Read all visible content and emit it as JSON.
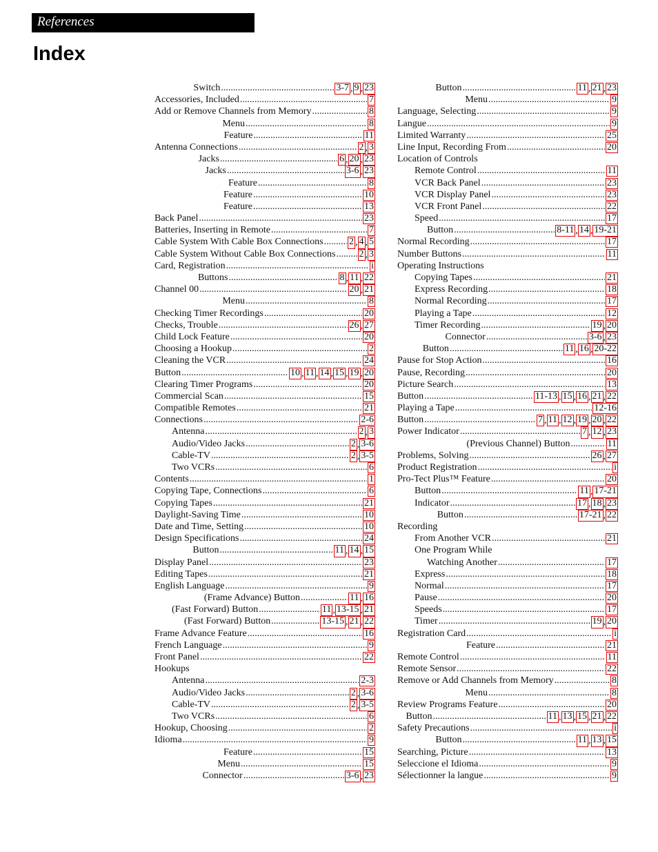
{
  "header": {
    "section": "References",
    "title": "Index"
  },
  "left_column": [
    {
      "label": "Switch",
      "indent": "center",
      "pages": [
        "3-7",
        "9",
        "23"
      ]
    },
    {
      "label": "Accessories, Included",
      "pages": [
        "7"
      ]
    },
    {
      "label": "Add or Remove Channels from Memory",
      "pages": [
        "8"
      ]
    },
    {
      "label": "Menu",
      "indent": "center",
      "pages": [
        "8"
      ]
    },
    {
      "label": "Feature",
      "indent": "center",
      "pages": [
        "11"
      ]
    },
    {
      "label": "Antenna Connections",
      "pages": [
        "2",
        "3"
      ]
    },
    {
      "label": "Jacks",
      "indent": "center",
      "pages": [
        "6",
        "20",
        "23"
      ]
    },
    {
      "label": "Jacks",
      "indent": "center",
      "pages": [
        "3-6",
        "23"
      ]
    },
    {
      "label": "Feature",
      "indent": "center",
      "pages": [
        "8"
      ]
    },
    {
      "label": "Feature",
      "indent": "center",
      "pages": [
        "10"
      ]
    },
    {
      "label": "Feature",
      "indent": "center",
      "pages": [
        "13"
      ]
    },
    {
      "label": "Back Panel",
      "pages": [
        "23"
      ]
    },
    {
      "label": "Batteries, Inserting in Remote",
      "pages": [
        "7"
      ]
    },
    {
      "label": "Cable System With Cable Box Connections",
      "pages": [
        "2",
        "4",
        "5"
      ]
    },
    {
      "label": "Cable System Without Cable Box Connections",
      "pages": [
        "2",
        "3"
      ]
    },
    {
      "label": "Card, Registration",
      "pages": [
        "i"
      ]
    },
    {
      "label": "Buttons",
      "indent": "center",
      "pages": [
        "8",
        "11",
        "22"
      ]
    },
    {
      "label": "Channel 00",
      "pages": [
        "20",
        "21"
      ]
    },
    {
      "label": "Menu",
      "indent": "center",
      "pages": [
        "8"
      ]
    },
    {
      "label": "Checking Timer Recordings",
      "pages": [
        "20"
      ]
    },
    {
      "label": "Checks, Trouble",
      "pages": [
        "26",
        "27"
      ]
    },
    {
      "label": "Child Lock Feature",
      "pages": [
        "20"
      ]
    },
    {
      "label": "Choosing a Hookup",
      "pages": [
        "2"
      ]
    },
    {
      "label": "Cleaning the VCR",
      "pages": [
        "24"
      ]
    },
    {
      "label": "Button",
      "indent": "center",
      "pages": [
        "10",
        "11",
        "14",
        "15",
        "19",
        "20"
      ]
    },
    {
      "label": "Clearing Timer Programs",
      "pages": [
        "20"
      ]
    },
    {
      "label": "Commercial Scan",
      "pages": [
        "15"
      ]
    },
    {
      "label": "Compatible Remotes",
      "pages": [
        "21"
      ]
    },
    {
      "label": "Connections",
      "pages": [
        "2-6"
      ]
    },
    {
      "label": "Antenna",
      "indent": "sub",
      "pages": [
        "2",
        "3"
      ]
    },
    {
      "label": "Audio/Video Jacks",
      "indent": "sub",
      "pages": [
        "2",
        "3-6"
      ]
    },
    {
      "label": "Cable-TV",
      "indent": "sub",
      "pages": [
        "2",
        "3-5"
      ]
    },
    {
      "label": "Two VCRs",
      "indent": "sub",
      "pages": [
        "6"
      ]
    },
    {
      "label": "Contents",
      "pages": [
        "1"
      ]
    },
    {
      "label": "Copying Tape, Connections",
      "pages": [
        "6"
      ]
    },
    {
      "label": "Copying Tapes",
      "pages": [
        "21"
      ]
    },
    {
      "label": "Daylight-Saving Time",
      "pages": [
        "10"
      ]
    },
    {
      "label": "Date and Time, Setting",
      "pages": [
        "10"
      ]
    },
    {
      "label": "Design Specifications",
      "pages": [
        "24"
      ]
    },
    {
      "label": "Button",
      "indent": "center",
      "pages": [
        "11",
        "14",
        "15"
      ]
    },
    {
      "label": "Display Panel",
      "pages": [
        "23"
      ]
    },
    {
      "label": "Editing Tapes",
      "pages": [
        "21"
      ]
    },
    {
      "label": "English Language",
      "pages": [
        "9"
      ]
    },
    {
      "label": "(Frame Advance) Button",
      "indent": "center",
      "pages": [
        "11",
        "16"
      ]
    },
    {
      "label": "(Fast Forward) Button",
      "indent": "sub",
      "pages": [
        "11",
        "13-15",
        "21"
      ]
    },
    {
      "label": "(Fast Forward) Button",
      "indent": "sub2",
      "pages": [
        "13-15",
        "21",
        "22"
      ]
    },
    {
      "label": "Frame Advance Feature",
      "pages": [
        "16"
      ]
    },
    {
      "label": "French Language",
      "pages": [
        "9"
      ]
    },
    {
      "label": "Front Panel",
      "pages": [
        "22"
      ]
    },
    {
      "label": "Hookups",
      "heading": true,
      "pages": []
    },
    {
      "label": "Antenna",
      "indent": "sub",
      "pages": [
        "2-3"
      ]
    },
    {
      "label": "Audio/Video Jacks",
      "indent": "sub",
      "pages": [
        "2",
        "3-6"
      ]
    },
    {
      "label": "Cable-TV",
      "indent": "sub",
      "pages": [
        "2",
        "3-5"
      ]
    },
    {
      "label": "Two VCRs",
      "indent": "sub",
      "pages": [
        "6"
      ]
    },
    {
      "label": "Hookup, Choosing",
      "pages": [
        "2"
      ]
    },
    {
      "label": "Idioma",
      "pages": [
        "9"
      ]
    },
    {
      "label": "Feature",
      "indent": "center",
      "pages": [
        "15"
      ]
    },
    {
      "label": "Menu",
      "indent": "center",
      "pages": [
        "15"
      ]
    },
    {
      "label": "Connector",
      "indent": "center",
      "pages": [
        "3-6",
        "23"
      ]
    }
  ],
  "right_column": [
    {
      "label": "Button",
      "indent": "center",
      "pages": [
        "11",
        "21",
        "23"
      ]
    },
    {
      "label": "Menu",
      "indent": "center",
      "pages": [
        "9"
      ]
    },
    {
      "label": "Language, Selecting",
      "pages": [
        "9"
      ]
    },
    {
      "label": "Langue",
      "pages": [
        "9"
      ]
    },
    {
      "label": "Limited Warranty",
      "pages": [
        "25"
      ]
    },
    {
      "label": "Line Input, Recording From",
      "pages": [
        "20"
      ]
    },
    {
      "label": "Location of Controls",
      "heading": true,
      "pages": []
    },
    {
      "label": "Remote Control",
      "indent": "sub",
      "pages": [
        "11"
      ]
    },
    {
      "label": "VCR Back Panel",
      "indent": "sub",
      "pages": [
        "23"
      ]
    },
    {
      "label": "VCR Display Panel",
      "indent": "sub",
      "pages": [
        "23"
      ]
    },
    {
      "label": "VCR Front Panel",
      "indent": "sub",
      "pages": [
        "22"
      ]
    },
    {
      "label": "Speed",
      "indent": "sub",
      "pages": [
        "17"
      ]
    },
    {
      "label": "Button",
      "indent": "sub2",
      "pages": [
        "8-11",
        "14",
        "19-21"
      ]
    },
    {
      "label": "Normal Recording",
      "pages": [
        "17"
      ]
    },
    {
      "label": "Number Buttons",
      "pages": [
        "11"
      ]
    },
    {
      "label": "Operating Instructions",
      "heading": true,
      "pages": []
    },
    {
      "label": "Copying Tapes",
      "indent": "sub",
      "pages": [
        "21"
      ]
    },
    {
      "label": "Express Recording",
      "indent": "sub",
      "pages": [
        "18"
      ]
    },
    {
      "label": "Normal Recording",
      "indent": "sub",
      "pages": [
        "17"
      ]
    },
    {
      "label": "Playing a Tape",
      "indent": "sub",
      "pages": [
        "12"
      ]
    },
    {
      "label": "Timer Recording",
      "indent": "sub",
      "pages": [
        "19",
        "20"
      ]
    },
    {
      "label": "Connector",
      "indent": "center",
      "pages": [
        "3-6",
        "23"
      ]
    },
    {
      "label": "Button",
      "indent": "center",
      "pages": [
        "11",
        "16",
        "20-22"
      ]
    },
    {
      "label": "Pause for Stop Action",
      "pages": [
        "16"
      ]
    },
    {
      "label": "Pause, Recording",
      "pages": [
        "20"
      ]
    },
    {
      "label": "Picture Search",
      "pages": [
        "13"
      ]
    },
    {
      "label": "Button",
      "indent": "center",
      "pages": [
        "11-13",
        "15",
        "16",
        "21",
        "22"
      ]
    },
    {
      "label": "Playing a Tape",
      "pages": [
        "12-16"
      ]
    },
    {
      "label": "Button",
      "indent": "center",
      "pages": [
        "7",
        "11",
        "12",
        "19",
        "20",
        "22"
      ]
    },
    {
      "label": "Power Indicator",
      "pages": [
        "7",
        "12",
        "23"
      ]
    },
    {
      "label": "(Previous Channel) Button",
      "indent": "center",
      "pages": [
        "11"
      ]
    },
    {
      "label": "Problems, Solving",
      "pages": [
        "26",
        "27"
      ]
    },
    {
      "label": "Product Registration",
      "pages": [
        "i"
      ]
    },
    {
      "label": "Pro-Tect Plus™ Feature",
      "pages": [
        "20"
      ]
    },
    {
      "label": "Button",
      "indent": "sub",
      "pages": [
        "11",
        "17-21"
      ]
    },
    {
      "label": "Indicator",
      "indent": "sub",
      "pages": [
        "17",
        "18",
        "23"
      ]
    },
    {
      "label": "Button",
      "indent": "center",
      "pages": [
        "17-21",
        "22"
      ]
    },
    {
      "label": "Recording",
      "heading": true,
      "pages": []
    },
    {
      "label": "From Another VCR",
      "indent": "sub",
      "pages": [
        "21"
      ]
    },
    {
      "label": "One Program While",
      "indent": "sub",
      "heading": true,
      "pages": []
    },
    {
      "label": "Watching Another",
      "indent": "sub2",
      "pages": [
        "17"
      ]
    },
    {
      "label": "Express",
      "indent": "sub",
      "pages": [
        "18"
      ]
    },
    {
      "label": "Normal",
      "indent": "sub",
      "pages": [
        "17"
      ]
    },
    {
      "label": "Pause",
      "indent": "sub",
      "pages": [
        "20"
      ]
    },
    {
      "label": "Speeds",
      "indent": "sub",
      "pages": [
        "17"
      ]
    },
    {
      "label": "Timer",
      "indent": "sub",
      "pages": [
        "19",
        "20"
      ]
    },
    {
      "label": "Registration Card",
      "pages": [
        "i"
      ]
    },
    {
      "label": "Feature",
      "indent": "center",
      "pages": [
        "21"
      ]
    },
    {
      "label": "Remote Control",
      "pages": [
        "11"
      ]
    },
    {
      "label": "Remote Sensor",
      "pages": [
        "22"
      ]
    },
    {
      "label": "Remove or Add Channels from Memory",
      "pages": [
        "8"
      ]
    },
    {
      "label": "Menu",
      "indent": "center",
      "pages": [
        "8"
      ]
    },
    {
      "label": "Review Programs Feature",
      "pages": [
        "20"
      ]
    },
    {
      "label": "Button",
      "indent": "center",
      "pages": [
        "11",
        "13",
        "15",
        "21",
        "22"
      ]
    },
    {
      "label": "Safety Precautions",
      "pages": [
        "i"
      ]
    },
    {
      "label": "Button",
      "indent": "center",
      "pages": [
        "11",
        "13",
        "15"
      ]
    },
    {
      "label": "Searching, Picture",
      "pages": [
        "13"
      ]
    },
    {
      "label": "Seleccione el Idioma",
      "pages": [
        "9"
      ]
    },
    {
      "label": "Sélectionner la langue",
      "pages": [
        "9"
      ]
    }
  ],
  "colors": {
    "header_bg": "#000000",
    "header_text": "#ffffff",
    "page_box": "#e00000"
  }
}
